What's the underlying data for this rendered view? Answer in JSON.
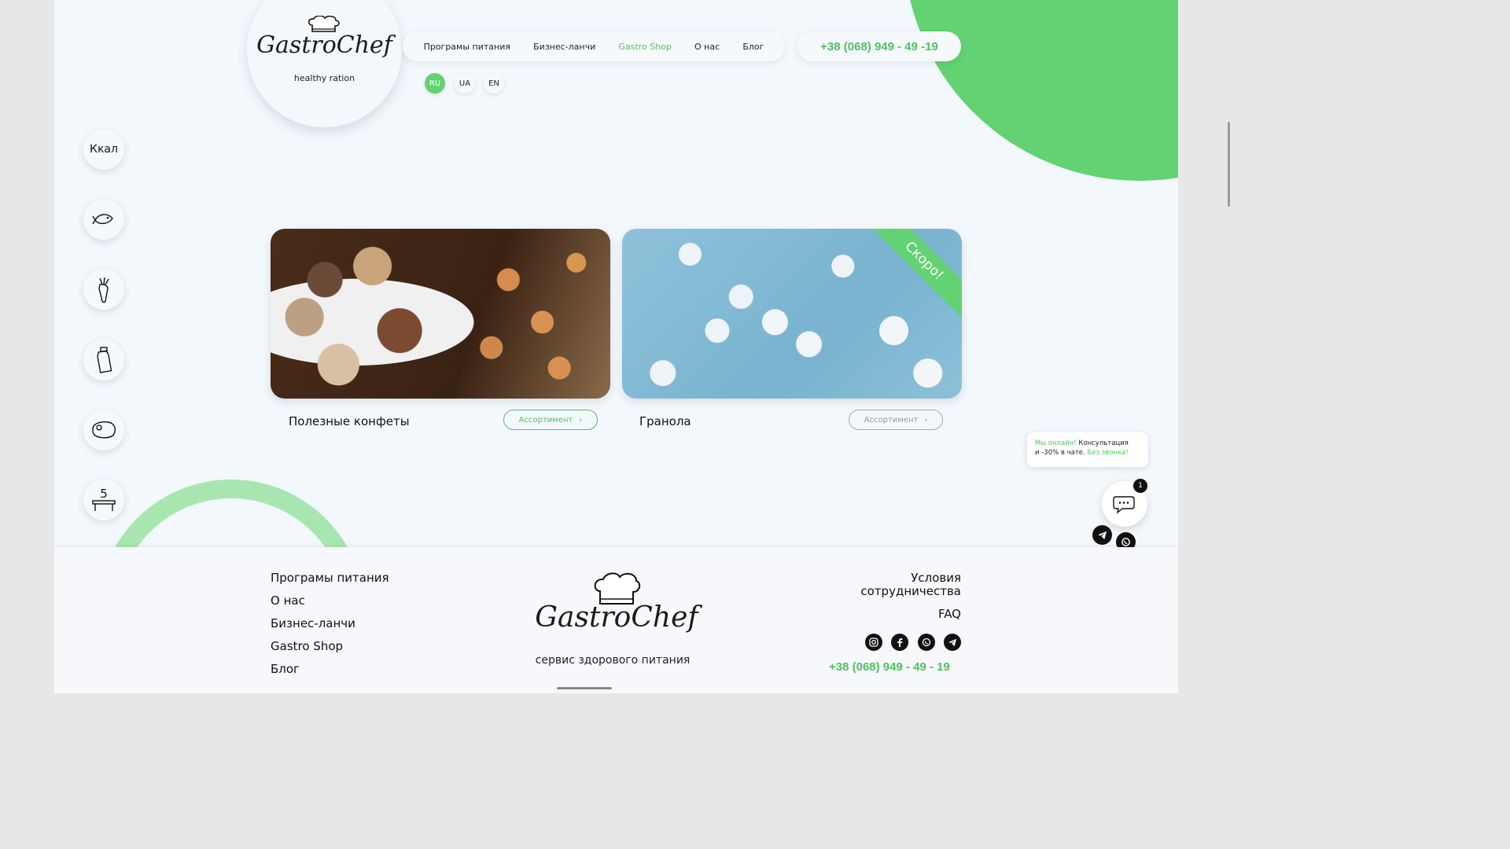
{
  "brand": {
    "logo_text": "GastroChef",
    "tagline": "healthy ration",
    "footer_tagline": "сервис здорового питания"
  },
  "nav": {
    "items": [
      {
        "label": "Програмы питания"
      },
      {
        "label": "Бизнес-ланчи"
      },
      {
        "label": "Gastro Shop"
      },
      {
        "label": "О нас"
      },
      {
        "label": "Блог"
      }
    ],
    "active": "Gastro Shop"
  },
  "phone": "+38 (068) 949 - 49 -19",
  "languages": [
    "RU",
    "UA",
    "EN"
  ],
  "active_language": "RU",
  "sidebar": {
    "kcal_label": "Ккал",
    "items": [
      "kcal",
      "fish-icon",
      "carrot-icon",
      "bottle-icon",
      "steak-icon",
      "table-icon"
    ],
    "table_number": "5"
  },
  "products": [
    {
      "title": "Полезные конфеты",
      "button": "Ассортимент",
      "enabled": true
    },
    {
      "title": "Гранола",
      "button": "Ассортимент",
      "enabled": false,
      "ribbon": "Скоро!"
    }
  ],
  "chat": {
    "online": "Мы онлайн!",
    "text1": "Консультация",
    "text2": "и -30% в чате.",
    "no_call": "Без звонка!",
    "badge": "1"
  },
  "footer": {
    "links": [
      "Програмы питания",
      "О нас",
      "Бизнес-ланчи",
      "Gastro Shop",
      "Блог"
    ],
    "right_line1": "Условия",
    "right_line2": "сотрудничества",
    "faq": "FAQ",
    "phone": "+38 (068) 949 - 49 - 19",
    "socials": [
      "instagram-icon",
      "facebook-icon",
      "viber-icon",
      "telegram-icon"
    ]
  },
  "colors": {
    "accent": "#63d272",
    "accent_text": "#4ec25f",
    "background": "#f3f8fd"
  }
}
